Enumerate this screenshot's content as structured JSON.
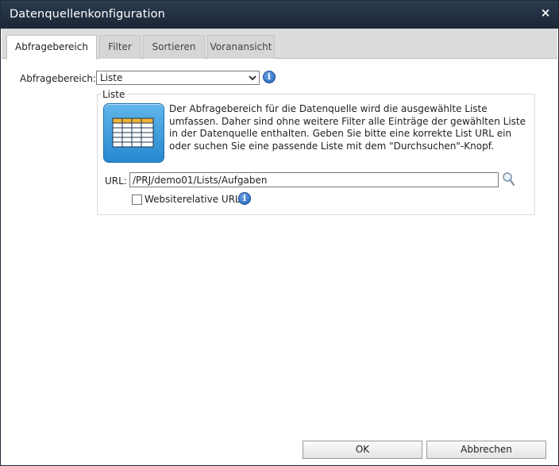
{
  "window": {
    "title": "Datenquellenkonfiguration",
    "close_symbol": "×"
  },
  "tabs": [
    {
      "label": "Abfragebereich",
      "active": true
    },
    {
      "label": "Filter",
      "active": false
    },
    {
      "label": "Sortieren",
      "active": false
    },
    {
      "label": "Voranansicht",
      "active": false
    }
  ],
  "scope": {
    "label": "Abfragebereich:",
    "selected": "Liste"
  },
  "group": {
    "title": "Liste",
    "icon": "list-table-icon",
    "description": "Der Abfragebereich für die Datenquelle wird die ausgewählte Liste umfassen. Daher sind ohne weitere Filter alle Einträge der gewählten Liste in der Datenquelle enthalten. Geben Sie bitte eine korrekte List URL ein oder suchen Sie eine passende Liste mit dem \"Durchsuchen\"-Knopf.",
    "url_label": "URL:",
    "url_value": "/PRJ/demo01/Lists/Aufgaben",
    "site_relative_label": "Websiterelative URL",
    "site_relative_checked": false
  },
  "buttons": {
    "ok": "OK",
    "cancel": "Abbrechen"
  },
  "colors": {
    "titlebar": "#1f2b3b",
    "accent_blue": "#2788cf",
    "info_blue": "#1f5fb5"
  }
}
